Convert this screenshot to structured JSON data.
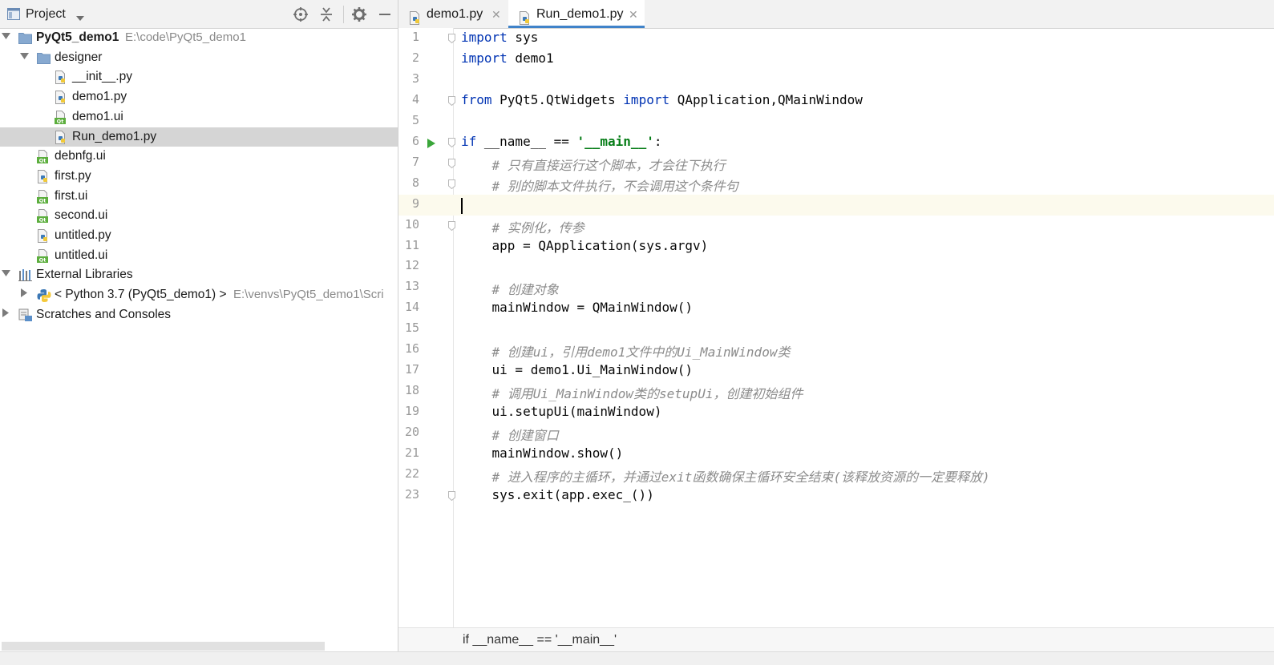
{
  "project_panel": {
    "title": "Project",
    "icons": [
      "project-icon",
      "chevron-down-icon",
      "locate-icon",
      "collapse-icon",
      "gear-icon",
      "minimize-icon"
    ]
  },
  "tree": [
    {
      "label": "PyQt5_demo1",
      "path": "E:\\code\\PyQt5_demo1",
      "icon": "folder-icon",
      "arrow": "down",
      "indent": 0,
      "bold": true
    },
    {
      "label": "designer",
      "icon": "folder-icon",
      "arrow": "down",
      "indent": 1
    },
    {
      "label": "__init__.py",
      "icon": "python-file-icon",
      "indent": 2
    },
    {
      "label": "demo1.py",
      "icon": "python-file-icon",
      "indent": 2
    },
    {
      "label": "demo1.ui",
      "icon": "qt-ui-file-icon",
      "indent": 2
    },
    {
      "label": "Run_demo1.py",
      "icon": "python-file-icon",
      "indent": 2,
      "selected": true
    },
    {
      "label": "debnfg.ui",
      "icon": "qt-ui-file-icon",
      "indent": 1
    },
    {
      "label": "first.py",
      "icon": "python-file-icon",
      "indent": 1
    },
    {
      "label": "first.ui",
      "icon": "qt-ui-file-icon",
      "indent": 1
    },
    {
      "label": "second.ui",
      "icon": "qt-ui-file-icon",
      "indent": 1
    },
    {
      "label": "untitled.py",
      "icon": "python-file-icon",
      "indent": 1
    },
    {
      "label": "untitled.ui",
      "icon": "qt-ui-file-icon",
      "indent": 1
    },
    {
      "label": "External Libraries",
      "icon": "library-icon",
      "arrow": "down",
      "indent": 0
    },
    {
      "label": "< Python 3.7 (PyQt5_demo1) >",
      "path": "E:\\venvs\\PyQt5_demo1\\Scri",
      "icon": "python-logo-icon",
      "arrow": "right",
      "indent": 1
    },
    {
      "label": "Scratches and Consoles",
      "icon": "scratches-icon",
      "arrow": "right",
      "indent": 0
    }
  ],
  "tabs": [
    {
      "label": "demo1.py",
      "close": "✕",
      "active": false
    },
    {
      "label": "Run_demo1.py",
      "close": "✕",
      "active": true
    }
  ],
  "editor": {
    "current_line": 9,
    "run_line": 6,
    "fold_lines": [
      1,
      4,
      6,
      7,
      8,
      10,
      23
    ],
    "lines": [
      {
        "n": "1",
        "tokens": [
          {
            "t": "import",
            "c": "kw"
          },
          {
            "t": " sys"
          }
        ]
      },
      {
        "n": "2",
        "tokens": [
          {
            "t": "import",
            "c": "kw"
          },
          {
            "t": " demo1"
          }
        ]
      },
      {
        "n": "3",
        "tokens": []
      },
      {
        "n": "4",
        "tokens": [
          {
            "t": "from",
            "c": "kw"
          },
          {
            "t": " PyQt5.QtWidgets "
          },
          {
            "t": "import",
            "c": "kw"
          },
          {
            "t": " QApplication,QMainWindow"
          }
        ]
      },
      {
        "n": "5",
        "tokens": []
      },
      {
        "n": "6",
        "tokens": [
          {
            "t": "if",
            "c": "kw"
          },
          {
            "t": " __name__ == "
          },
          {
            "t": "'__main__'",
            "c": "str"
          },
          {
            "t": ":"
          }
        ]
      },
      {
        "n": "7",
        "tokens": [
          {
            "t": "    "
          },
          {
            "t": "# 只有直接运行这个脚本，才会往下执行",
            "c": "cm"
          }
        ]
      },
      {
        "n": "8",
        "tokens": [
          {
            "t": "    "
          },
          {
            "t": "# 别的脚本文件执行，不会调用这个条件句",
            "c": "cm"
          }
        ]
      },
      {
        "n": "9",
        "tokens": []
      },
      {
        "n": "10",
        "tokens": [
          {
            "t": "    "
          },
          {
            "t": "# 实例化，传参",
            "c": "cm"
          }
        ]
      },
      {
        "n": "11",
        "tokens": [
          {
            "t": "    app = QApplication(sys.argv)"
          }
        ]
      },
      {
        "n": "12",
        "tokens": []
      },
      {
        "n": "13",
        "tokens": [
          {
            "t": "    "
          },
          {
            "t": "# 创建对象",
            "c": "cm"
          }
        ]
      },
      {
        "n": "14",
        "tokens": [
          {
            "t": "    mainWindow = QMainWindow()"
          }
        ]
      },
      {
        "n": "15",
        "tokens": []
      },
      {
        "n": "16",
        "tokens": [
          {
            "t": "    "
          },
          {
            "t": "# 创建ui，引用demo1文件中的Ui_MainWindow类",
            "c": "cm"
          }
        ]
      },
      {
        "n": "17",
        "tokens": [
          {
            "t": "    ui = demo1.Ui_MainWindow()"
          }
        ]
      },
      {
        "n": "18",
        "tokens": [
          {
            "t": "    "
          },
          {
            "t": "# 调用Ui_MainWindow类的setupUi，创建初始组件",
            "c": "cm"
          }
        ]
      },
      {
        "n": "19",
        "tokens": [
          {
            "t": "    ui.setupUi(mainWindow)"
          }
        ]
      },
      {
        "n": "20",
        "tokens": [
          {
            "t": "    "
          },
          {
            "t": "# 创建窗口",
            "c": "cm"
          }
        ]
      },
      {
        "n": "21",
        "tokens": [
          {
            "t": "    mainWindow.show()"
          }
        ]
      },
      {
        "n": "22",
        "tokens": [
          {
            "t": "    "
          },
          {
            "t": "# 进入程序的主循环，并通过exit函数确保主循环安全结束(该释放资源的一定要释放)",
            "c": "cm"
          }
        ]
      },
      {
        "n": "23",
        "tokens": [
          {
            "t": "    sys.exit(app.exec_())"
          }
        ]
      }
    ]
  },
  "breadcrumb": "if __name__ == '__main__'",
  "colors": {
    "keyword": "#0033b3",
    "string": "#067d17",
    "comment": "#8c8c8c",
    "selection": "#d5d5d5",
    "tab_underline": "#4083c9",
    "current_line": "#fcfaed"
  }
}
